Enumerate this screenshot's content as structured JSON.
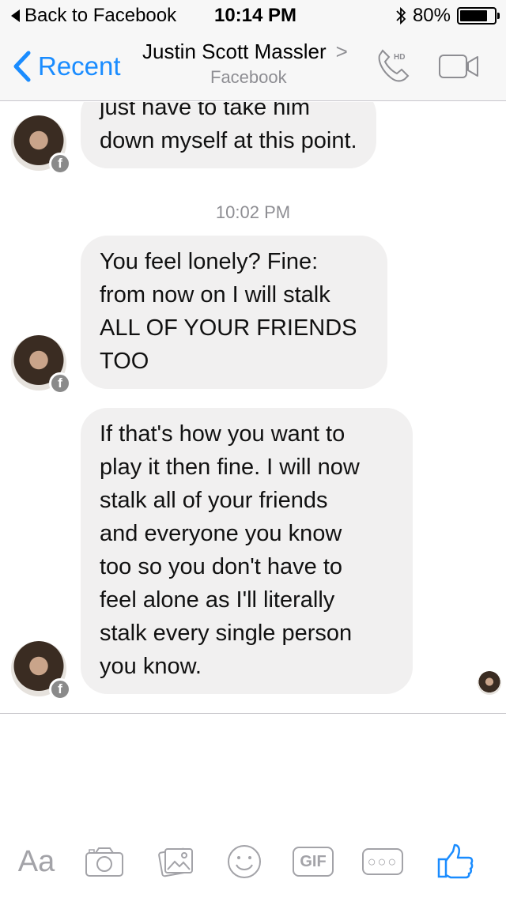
{
  "status_bar": {
    "back_label": "Back to Facebook",
    "time": "10:14 PM",
    "battery": "80%",
    "battery_level": 0.8,
    "icons": [
      "back-triangle-icon",
      "bluetooth-icon",
      "battery-icon"
    ]
  },
  "nav": {
    "back_label": "Recent",
    "title": "Justin Scott Massler",
    "chevron": ">",
    "subtitle": "Facebook",
    "accent_color": "#1a8cff",
    "phone_badge": "HD",
    "icons": [
      "back-chevron-icon",
      "hd-phone-icon",
      "video-camera-icon"
    ]
  },
  "messages": [
    {
      "lines": [
        "just have to take him",
        "down myself at this point."
      ]
    },
    {
      "lines": [
        "You feel lonely? Fine:",
        "from now on I will stalk",
        "ALL OF YOUR FRIENDS",
        "TOO"
      ]
    },
    {
      "lines": [
        "If that's how you want to",
        "play it then fine. I will now",
        "stalk all of your friends",
        "and everyone you know",
        "too so you don't have to",
        "feel alone as I'll literally",
        "stalk every single person",
        "you know."
      ]
    }
  ],
  "timestamp": "10:02 PM",
  "bubble_color": "#f1f0f0",
  "toolbar": {
    "aa_label": "Aa",
    "gif_label": "GIF",
    "more_label": "○○○",
    "icon_color": "#a3a3a8",
    "like_color": "#1a8cff",
    "icons": [
      "camera-icon",
      "photo-gallery-icon",
      "emoji-icon",
      "thumbs-up-icon"
    ]
  }
}
